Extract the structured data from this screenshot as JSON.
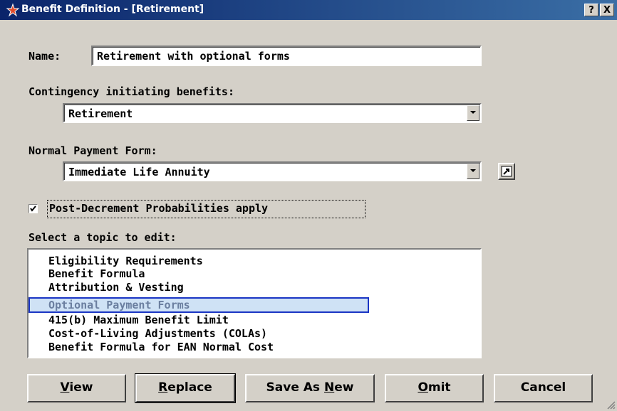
{
  "window": {
    "title": "Benefit Definition - [Retirement]",
    "help_btn": "?",
    "close_btn": "X"
  },
  "name": {
    "label": "Name:",
    "value": "Retirement with optional forms"
  },
  "contingency": {
    "label": "Contingency initiating benefits:",
    "value": "Retirement"
  },
  "payment_form": {
    "label": "Normal Payment Form:",
    "value": "Immediate Life Annuity"
  },
  "post_decrement": {
    "label": "Post-Decrement Probabilities apply",
    "checked": true
  },
  "topics": {
    "label": "Select a topic to edit:",
    "items": [
      "Eligibility Requirements",
      "Benefit Formula",
      "Attribution & Vesting",
      "Optional Payment Forms",
      "415(b) Maximum Benefit Limit",
      "Cost-of-Living Adjustments (COLAs)",
      "Benefit Formula for EAN Normal Cost"
    ],
    "selected_index": 3
  },
  "buttons": {
    "view": {
      "mnemonic": "V",
      "rest": "iew"
    },
    "replace": {
      "mnemonic": "R",
      "rest": "eplace"
    },
    "save_as_new": {
      "pre": "Save As ",
      "mnemonic": "N",
      "rest": "ew"
    },
    "omit": {
      "mnemonic": "O",
      "rest": "mit"
    },
    "cancel": {
      "label": "Cancel"
    }
  }
}
